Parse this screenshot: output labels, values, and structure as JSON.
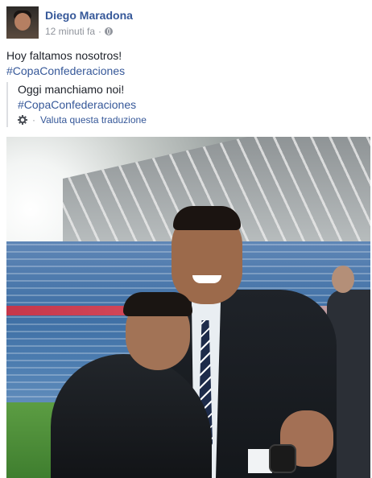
{
  "post": {
    "author": "Diego Maradona",
    "timestamp": "12 minuti fa",
    "separator": "·",
    "privacy_icon": "globe-icon",
    "text": "Hoy faltamos nosotros!",
    "hashtag": "#CopaConfederaciones",
    "translation": {
      "text": "Oggi manchiamo noi!",
      "hashtag": "#CopaConfederaciones",
      "rate_icon": "gear-icon",
      "separator": "·",
      "rate_label": "Valuta questa traduzione"
    }
  },
  "colors": {
    "link": "#365899",
    "muted": "#90949c",
    "text": "#1d2129"
  }
}
